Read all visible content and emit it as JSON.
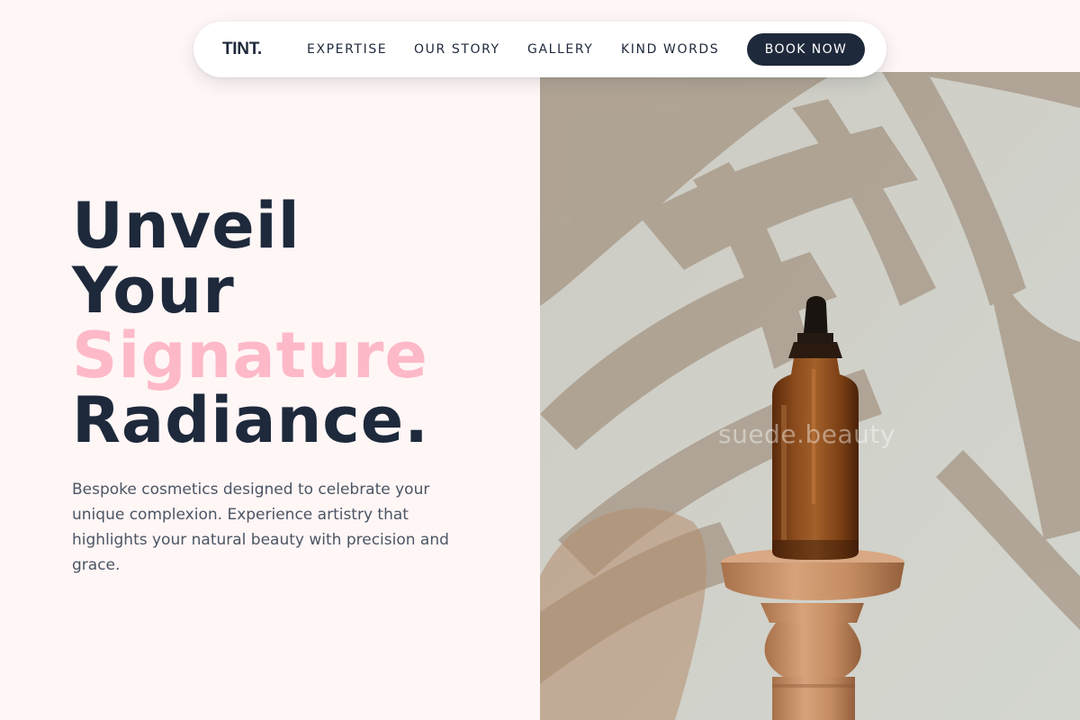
{
  "nav": {
    "logo": "TINT.",
    "links": [
      "EXPERTISE",
      "OUR STORY",
      "GALLERY",
      "KIND WORDS"
    ],
    "cta": "BOOK NOW"
  },
  "hero": {
    "title_lines": [
      "Unveil",
      "Your",
      "Signature",
      "Radiance."
    ],
    "description": "Bespoke cosmetics designed to celebrate your unique complexion. Experience artistry that highlights your natural beauty with precision and grace.",
    "image_watermark": "suede.beauty"
  },
  "colors": {
    "page_background": "#fff6f6",
    "navy": "#1e293b",
    "accent_pink": "#fdb9c8",
    "body_text": "#4b5563"
  },
  "icons": [
    "amber-dropper-bottle-image",
    "wooden-pedestal-image",
    "palm-shadow-image"
  ]
}
